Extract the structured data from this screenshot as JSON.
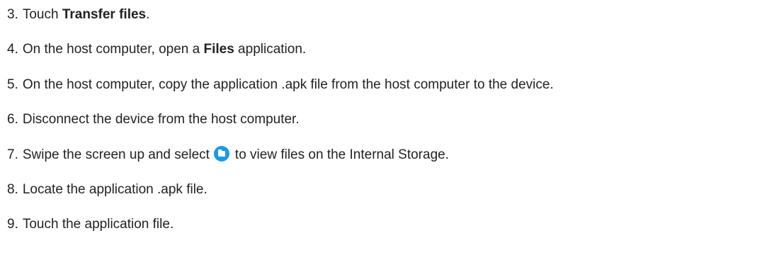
{
  "steps": [
    {
      "number": "3.",
      "before": "Touch ",
      "bold": "Transfer files",
      "after": "."
    },
    {
      "number": "4.",
      "before": "On the host computer, open a ",
      "bold": "Files",
      "after": " application."
    },
    {
      "number": "5.",
      "text": "On the host computer, copy the application .apk file from the host computer to the device."
    },
    {
      "number": "6.",
      "text": "Disconnect the device from the host computer."
    },
    {
      "number": "7.",
      "before": "Swipe the screen up and select",
      "icon": "files-app-icon",
      "after": "to view files on the Internal Storage."
    },
    {
      "number": "8.",
      "text": "Locate the application .apk file."
    },
    {
      "number": "9.",
      "text": "Touch the application file."
    }
  ],
  "colors": {
    "text": "#222222",
    "icon_accent": "#1a9ae6"
  }
}
